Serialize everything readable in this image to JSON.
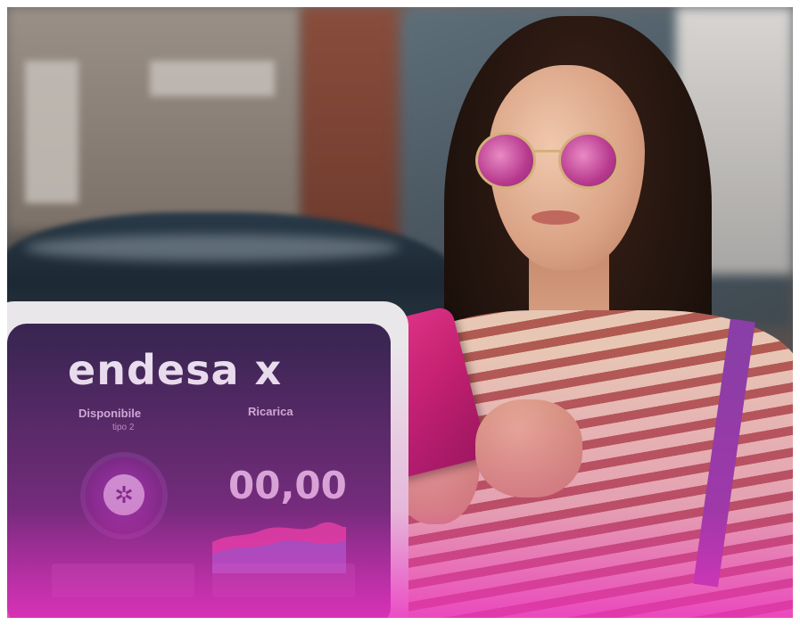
{
  "charger": {
    "brand": "endesa x",
    "status_label": "Disponibile",
    "status_sub": "tipo 2",
    "charge_label": "Ricarica",
    "reading": "00,00",
    "colors": {
      "screen": "#4a2b63",
      "accent": "#8c3aa7",
      "wash": "#eb32be"
    }
  },
  "scene": {
    "phone_color": "#e5388e",
    "icons": [
      "connector-icon"
    ]
  }
}
